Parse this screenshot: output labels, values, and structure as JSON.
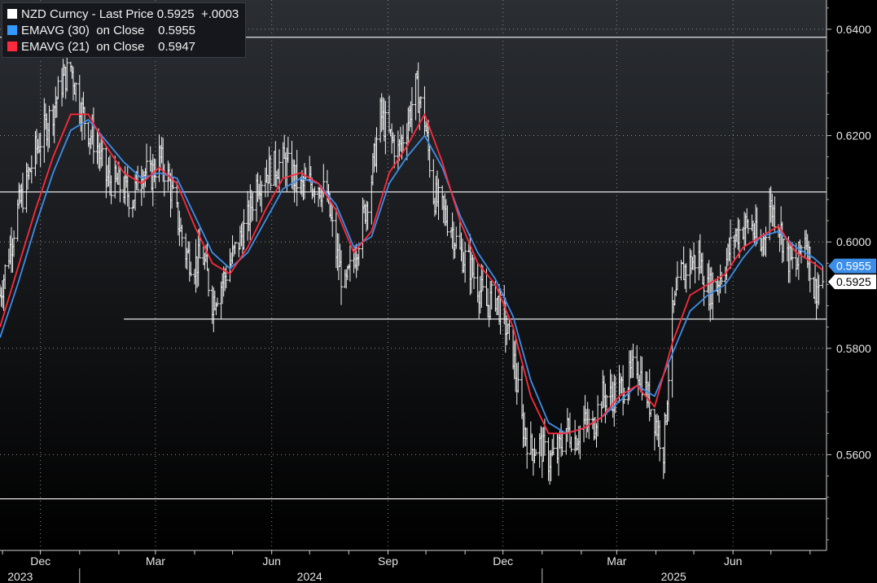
{
  "legend": {
    "rows": [
      {
        "name": "NZD Curncy - Last Price",
        "value": "0.5925",
        "change": "+.0003",
        "color": "#ffffff"
      },
      {
        "name": "EMAVG (30)  on Close",
        "value": "0.5955",
        "color": "#3399ff"
      },
      {
        "name": "EMAVG (21)  on Close",
        "value": "0.5947",
        "color": "#ff2a3c"
      }
    ]
  },
  "price_tags": [
    {
      "label": "0.5955",
      "value": 0.5955,
      "color": "#3d8ee8"
    },
    {
      "label": "0.5925",
      "value": 0.5925,
      "color": "#ffffff"
    }
  ],
  "chart_data": {
    "type": "line",
    "title": "",
    "xlabel": "",
    "ylabel": "",
    "ylim": [
      0.542,
      0.6455
    ],
    "y_ticks": [
      "0.5600",
      "0.5800",
      "0.6000",
      "0.6200",
      "0.6400"
    ],
    "x_months": [
      {
        "label": "Dec",
        "date": "2023-12-01"
      },
      {
        "label": "Mar",
        "date": "2024-03-01"
      },
      {
        "label": "Jun",
        "date": "2024-06-01"
      },
      {
        "label": "Sep",
        "date": "2024-09-01"
      },
      {
        "label": "Dec",
        "date": "2024-12-01"
      },
      {
        "label": "Mar",
        "date": "2025-03-01"
      },
      {
        "label": "Jun",
        "date": "2025-06-01"
      }
    ],
    "x_years": [
      {
        "label": "2023",
        "date": "2023-11-15"
      },
      {
        "label": "2024",
        "date": "2024-07-01"
      },
      {
        "label": "2025",
        "date": "2025-04-15"
      }
    ],
    "x_range": [
      "2023-10-30",
      "2025-08-14"
    ],
    "horizontal_lines": [
      0.6385,
      0.6094,
      0.5517
    ],
    "partial_lines": [
      {
        "value": 0.5855,
        "from": "2024-02-05"
      }
    ],
    "series": [
      {
        "name": "NZD Curncy - Last Price",
        "color": "#ffffff",
        "points": [
          [
            "2023-10-30",
            0.59
          ],
          [
            "2023-11-06",
            0.598
          ],
          [
            "2023-11-13",
            0.606
          ],
          [
            "2023-11-20",
            0.611
          ],
          [
            "2023-11-27",
            0.617
          ],
          [
            "2023-12-04",
            0.621
          ],
          [
            "2023-12-11",
            0.625
          ],
          [
            "2023-12-18",
            0.63
          ],
          [
            "2023-12-25",
            0.633
          ],
          [
            "2024-01-01",
            0.626
          ],
          [
            "2024-01-08",
            0.621
          ],
          [
            "2024-01-15",
            0.618
          ],
          [
            "2024-01-22",
            0.612
          ],
          [
            "2024-01-29",
            0.611
          ],
          [
            "2024-02-05",
            0.61
          ],
          [
            "2024-02-12",
            0.608
          ],
          [
            "2024-02-19",
            0.614
          ],
          [
            "2024-02-26",
            0.612
          ],
          [
            "2024-03-04",
            0.616
          ],
          [
            "2024-03-11",
            0.612
          ],
          [
            "2024-03-18",
            0.605
          ],
          [
            "2024-03-25",
            0.598
          ],
          [
            "2024-04-01",
            0.596
          ],
          [
            "2024-04-08",
            0.597
          ],
          [
            "2024-04-15",
            0.589
          ],
          [
            "2024-04-22",
            0.592
          ],
          [
            "2024-04-29",
            0.596
          ],
          [
            "2024-05-06",
            0.6
          ],
          [
            "2024-05-13",
            0.604
          ],
          [
            "2024-05-20",
            0.611
          ],
          [
            "2024-05-27",
            0.613
          ],
          [
            "2024-06-03",
            0.614
          ],
          [
            "2024-06-10",
            0.615
          ],
          [
            "2024-06-17",
            0.613
          ],
          [
            "2024-06-24",
            0.61
          ],
          [
            "2024-07-01",
            0.611
          ],
          [
            "2024-07-08",
            0.611
          ],
          [
            "2024-07-15",
            0.608
          ],
          [
            "2024-07-22",
            0.598
          ],
          [
            "2024-07-29",
            0.591
          ],
          [
            "2024-08-05",
            0.597
          ],
          [
            "2024-08-12",
            0.604
          ],
          [
            "2024-08-19",
            0.612
          ],
          [
            "2024-08-26",
            0.624
          ],
          [
            "2024-09-02",
            0.62
          ],
          [
            "2024-09-09",
            0.617
          ],
          [
            "2024-09-16",
            0.622
          ],
          [
            "2024-09-23",
            0.629
          ],
          [
            "2024-09-30",
            0.623
          ],
          [
            "2024-10-07",
            0.609
          ],
          [
            "2024-10-14",
            0.606
          ],
          [
            "2024-10-21",
            0.603
          ],
          [
            "2024-10-28",
            0.598
          ],
          [
            "2024-11-04",
            0.596
          ],
          [
            "2024-11-11",
            0.592
          ],
          [
            "2024-11-18",
            0.588
          ],
          [
            "2024-11-25",
            0.59
          ],
          [
            "2024-12-02",
            0.585
          ],
          [
            "2024-12-09",
            0.579
          ],
          [
            "2024-12-16",
            0.566
          ],
          [
            "2024-12-23",
            0.561
          ],
          [
            "2024-12-30",
            0.562
          ],
          [
            "2025-01-06",
            0.559
          ],
          [
            "2025-01-13",
            0.56
          ],
          [
            "2025-01-20",
            0.565
          ],
          [
            "2025-01-27",
            0.563
          ],
          [
            "2025-02-03",
            0.566
          ],
          [
            "2025-02-10",
            0.565
          ],
          [
            "2025-02-17",
            0.571
          ],
          [
            "2025-02-24",
            0.571
          ],
          [
            "2025-03-03",
            0.572
          ],
          [
            "2025-03-10",
            0.574
          ],
          [
            "2025-03-17",
            0.577
          ],
          [
            "2025-03-24",
            0.572
          ],
          [
            "2025-03-31",
            0.567
          ],
          [
            "2025-04-07",
            0.561
          ],
          [
            "2025-04-14",
            0.586
          ],
          [
            "2025-04-21",
            0.594
          ],
          [
            "2025-04-28",
            0.596
          ],
          [
            "2025-05-05",
            0.597
          ],
          [
            "2025-05-12",
            0.591
          ],
          [
            "2025-05-19",
            0.592
          ],
          [
            "2025-05-26",
            0.596
          ],
          [
            "2025-06-02",
            0.601
          ],
          [
            "2025-06-09",
            0.603
          ],
          [
            "2025-06-16",
            0.603
          ],
          [
            "2025-06-23",
            0.598
          ],
          [
            "2025-06-30",
            0.607
          ],
          [
            "2025-07-07",
            0.604
          ],
          [
            "2025-07-14",
            0.597
          ],
          [
            "2025-07-21",
            0.595
          ],
          [
            "2025-07-28",
            0.602
          ],
          [
            "2025-08-04",
            0.591
          ],
          [
            "2025-08-11",
            0.5925
          ]
        ]
      },
      {
        "name": "EMAVG (30) on Close",
        "color": "#3d8ee8",
        "points": [
          [
            "2023-10-30",
            0.582
          ],
          [
            "2023-11-13",
            0.592
          ],
          [
            "2023-11-27",
            0.603
          ],
          [
            "2023-12-11",
            0.613
          ],
          [
            "2023-12-25",
            0.621
          ],
          [
            "2024-01-08",
            0.623
          ],
          [
            "2024-01-22",
            0.619
          ],
          [
            "2024-02-05",
            0.615
          ],
          [
            "2024-02-19",
            0.612
          ],
          [
            "2024-03-04",
            0.613
          ],
          [
            "2024-03-18",
            0.612
          ],
          [
            "2024-04-01",
            0.605
          ],
          [
            "2024-04-15",
            0.598
          ],
          [
            "2024-04-29",
            0.595
          ],
          [
            "2024-05-13",
            0.598
          ],
          [
            "2024-05-27",
            0.604
          ],
          [
            "2024-06-10",
            0.61
          ],
          [
            "2024-06-24",
            0.612
          ],
          [
            "2024-07-08",
            0.611
          ],
          [
            "2024-07-22",
            0.607
          ],
          [
            "2024-08-05",
            0.599
          ],
          [
            "2024-08-19",
            0.601
          ],
          [
            "2024-09-02",
            0.611
          ],
          [
            "2024-09-16",
            0.616
          ],
          [
            "2024-09-30",
            0.62
          ],
          [
            "2024-10-14",
            0.614
          ],
          [
            "2024-10-28",
            0.605
          ],
          [
            "2024-11-11",
            0.598
          ],
          [
            "2024-11-25",
            0.593
          ],
          [
            "2024-12-09",
            0.586
          ],
          [
            "2024-12-23",
            0.574
          ],
          [
            "2025-01-06",
            0.566
          ],
          [
            "2025-01-20",
            0.564
          ],
          [
            "2025-02-03",
            0.565
          ],
          [
            "2025-02-17",
            0.567
          ],
          [
            "2025-03-03",
            0.57
          ],
          [
            "2025-03-17",
            0.573
          ],
          [
            "2025-03-31",
            0.571
          ],
          [
            "2025-04-14",
            0.579
          ],
          [
            "2025-04-28",
            0.587
          ],
          [
            "2025-05-12",
            0.59
          ],
          [
            "2025-05-26",
            0.592
          ],
          [
            "2025-06-09",
            0.597
          ],
          [
            "2025-06-23",
            0.601
          ],
          [
            "2025-07-07",
            0.602
          ],
          [
            "2025-07-21",
            0.599
          ],
          [
            "2025-08-04",
            0.597
          ],
          [
            "2025-08-11",
            0.5955
          ]
        ]
      },
      {
        "name": "EMAVG (21) on Close",
        "color": "#ff2a3c",
        "points": [
          [
            "2023-10-30",
            0.584
          ],
          [
            "2023-11-13",
            0.595
          ],
          [
            "2023-11-27",
            0.606
          ],
          [
            "2023-12-11",
            0.616
          ],
          [
            "2023-12-25",
            0.624
          ],
          [
            "2024-01-08",
            0.624
          ],
          [
            "2024-01-22",
            0.618
          ],
          [
            "2024-02-05",
            0.613
          ],
          [
            "2024-02-19",
            0.611
          ],
          [
            "2024-03-04",
            0.614
          ],
          [
            "2024-03-18",
            0.611
          ],
          [
            "2024-04-01",
            0.603
          ],
          [
            "2024-04-15",
            0.596
          ],
          [
            "2024-04-29",
            0.594
          ],
          [
            "2024-05-13",
            0.599
          ],
          [
            "2024-05-27",
            0.606
          ],
          [
            "2024-06-10",
            0.612
          ],
          [
            "2024-06-24",
            0.613
          ],
          [
            "2024-07-08",
            0.611
          ],
          [
            "2024-07-22",
            0.606
          ],
          [
            "2024-08-05",
            0.598
          ],
          [
            "2024-08-19",
            0.602
          ],
          [
            "2024-09-02",
            0.613
          ],
          [
            "2024-09-16",
            0.618
          ],
          [
            "2024-09-30",
            0.624
          ],
          [
            "2024-10-14",
            0.615
          ],
          [
            "2024-10-28",
            0.604
          ],
          [
            "2024-11-11",
            0.596
          ],
          [
            "2024-11-25",
            0.592
          ],
          [
            "2024-12-09",
            0.584
          ],
          [
            "2024-12-23",
            0.571
          ],
          [
            "2025-01-06",
            0.564
          ],
          [
            "2025-01-20",
            0.564
          ],
          [
            "2025-02-03",
            0.565
          ],
          [
            "2025-02-17",
            0.567
          ],
          [
            "2025-03-03",
            0.571
          ],
          [
            "2025-03-17",
            0.573
          ],
          [
            "2025-03-31",
            0.569
          ],
          [
            "2025-04-14",
            0.581
          ],
          [
            "2025-04-28",
            0.59
          ],
          [
            "2025-05-12",
            0.592
          ],
          [
            "2025-05-26",
            0.594
          ],
          [
            "2025-06-09",
            0.599
          ],
          [
            "2025-06-23",
            0.601
          ],
          [
            "2025-07-07",
            0.603
          ],
          [
            "2025-07-21",
            0.598
          ],
          [
            "2025-08-04",
            0.596
          ],
          [
            "2025-08-11",
            0.5947
          ]
        ]
      }
    ]
  }
}
